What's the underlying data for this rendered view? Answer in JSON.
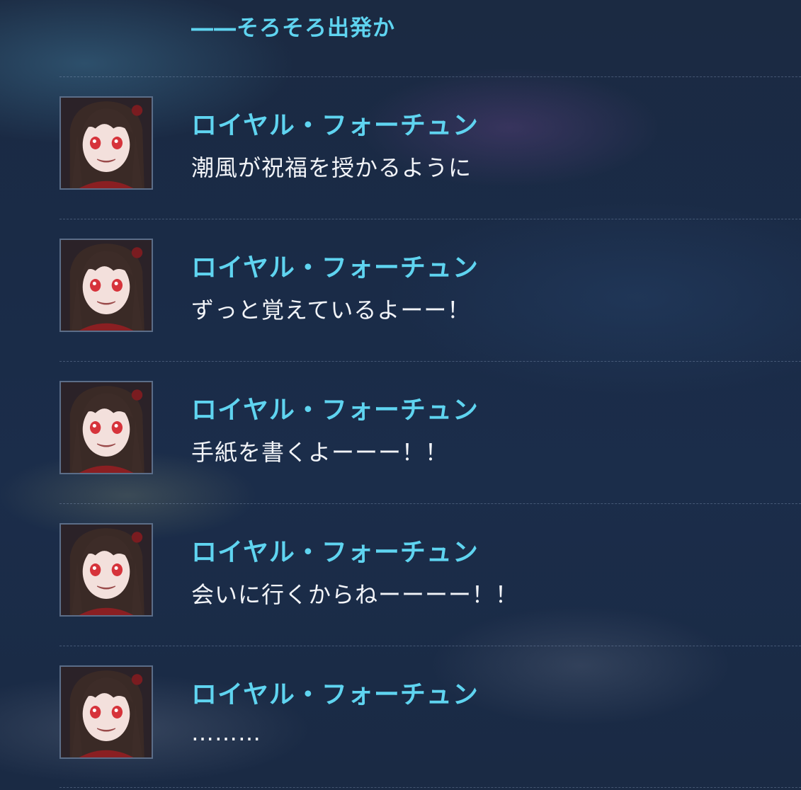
{
  "top_line": "――そろそろ出発か",
  "entries": [
    {
      "speaker": "ロイヤル・フォーチュン",
      "text": "潮風が祝福を授かるように",
      "avatar_icon": "royal-fortune-portrait-icon"
    },
    {
      "speaker": "ロイヤル・フォーチュン",
      "text": "ずっと覚えているよーー！",
      "avatar_icon": "royal-fortune-portrait-icon"
    },
    {
      "speaker": "ロイヤル・フォーチュン",
      "text": "手紙を書くよーーー！！",
      "avatar_icon": "royal-fortune-portrait-icon"
    },
    {
      "speaker": "ロイヤル・フォーチュン",
      "text": "会いに行くからねーーーー！！",
      "avatar_icon": "royal-fortune-portrait-icon"
    },
    {
      "speaker": "ロイヤル・フォーチュン",
      "text": "………",
      "avatar_icon": "royal-fortune-portrait-icon"
    }
  ],
  "colors": {
    "speaker": "#5fd4f0",
    "text": "#f2f4f8",
    "avatar_border": "#5b6d88"
  }
}
